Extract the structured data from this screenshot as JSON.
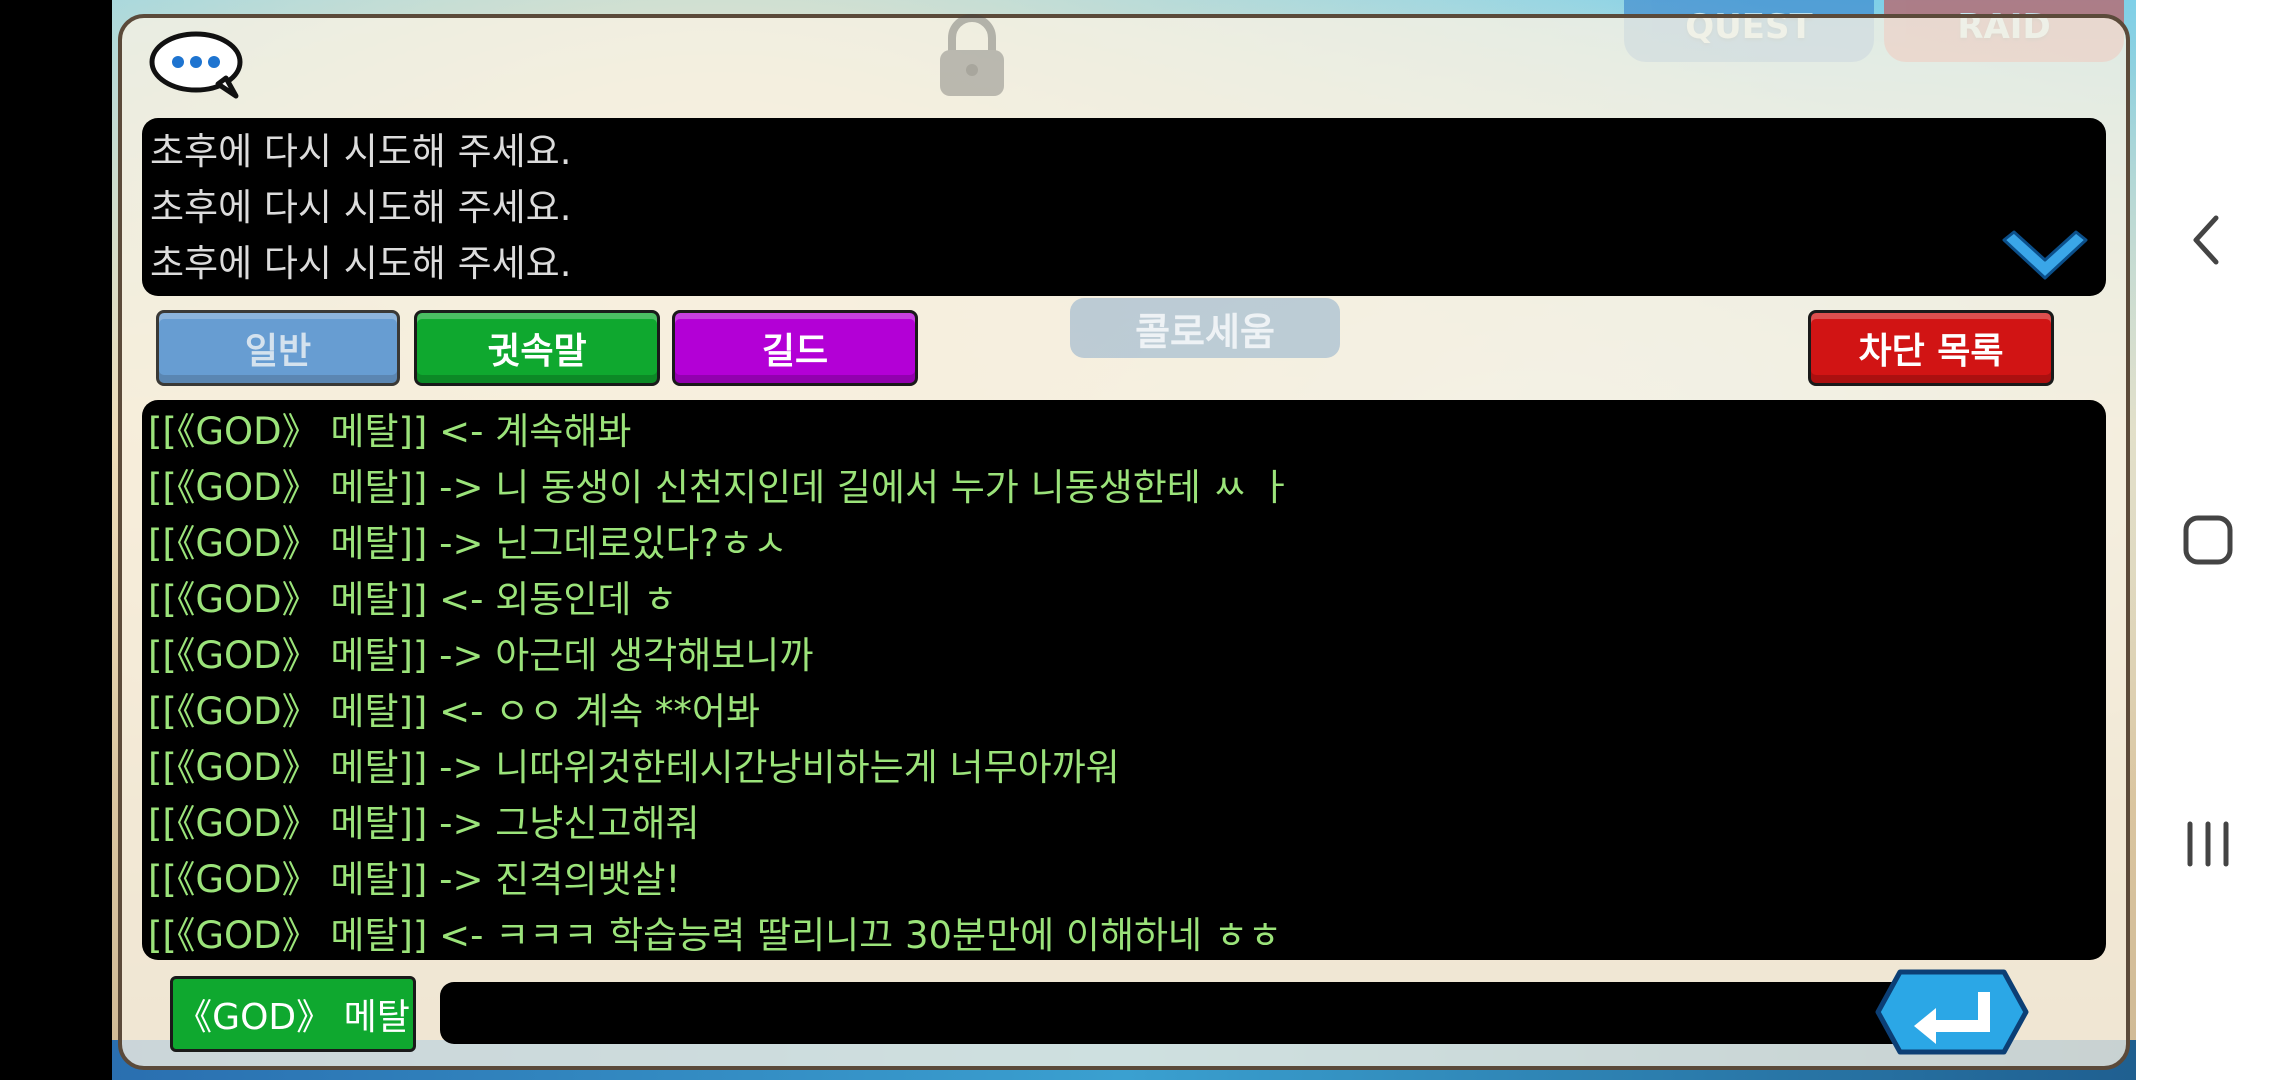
{
  "game_tabs": {
    "quest": "QUEST",
    "raid": "RAID"
  },
  "system_messages": [
    "초후에 다시 시도해 주세요.",
    "초후에 다시 시도해 주세요.",
    "초후에 다시 시도해 주세요."
  ],
  "channel_tabs": {
    "general": "일반",
    "whisper": "귓속말",
    "guild": "길드",
    "block_list": "차단 목록"
  },
  "background_label": "콜로세움",
  "chat_log": [
    "[[《GOD》 메탈]] <- 계속해봐",
    "[[《GOD》 메탈]] -> 니 동생이 신천지인데 길에서 누가 니동생한테 ㅆ ㅏ",
    "[[《GOD》 메탈]] -> 닌그데로있다?ㅎㅅ",
    "[[《GOD》 메탈]] <- 외동인데 ㅎ",
    "[[《GOD》 메탈]] -> 아근데 생각해보니까",
    "[[《GOD》 메탈]] <- ㅇㅇ 계속 **어봐",
    "[[《GOD》 메탈]] -> 니따위것한테시간낭비하는게 너무아까워",
    "[[《GOD》 메탈]] -> 그냥신고해줘",
    "[[《GOD》 메탈]] -> 진격의뱃살!",
    "[[《GOD》 메탈]] <- ㅋㅋㅋ 학습능력 딸리니끄 30분만에 이해하네 ㅎㅎ"
  ],
  "input": {
    "recipient": "《GOD》 메탈",
    "value": "",
    "placeholder": ""
  },
  "icons": {
    "chat": "speech-bubble-icon",
    "lock": "lock-icon",
    "scroll": "chevron-down-icon",
    "send": "enter-arrow-icon",
    "nav_back": "back-icon",
    "nav_home": "home-icon",
    "nav_recents": "recents-icon"
  },
  "colors": {
    "whisper_text": "#9be37a",
    "system_text": "#dcdcdc",
    "whisper_tab": "#0fa82f",
    "guild_tab": "#b300d6",
    "block_tab": "#d11414",
    "general_tab": "#4f8fd1"
  }
}
